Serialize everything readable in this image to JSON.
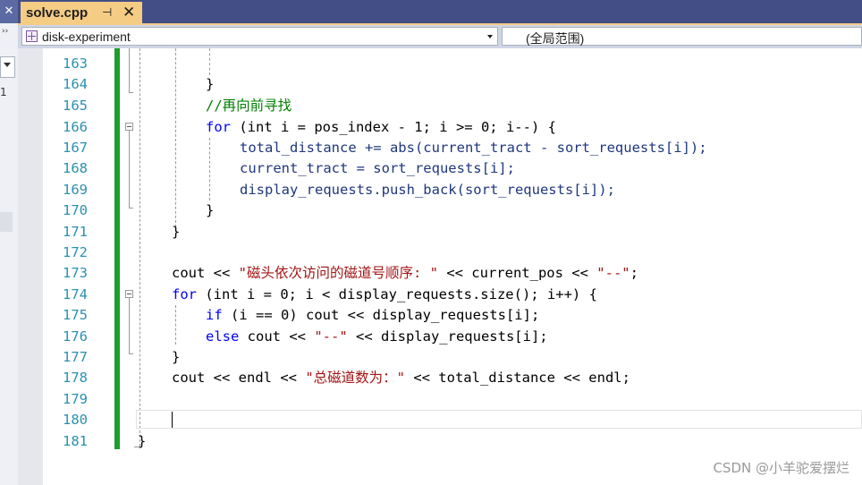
{
  "left_panel": {
    "close_glyph": "✕",
    "arrows_glyph": "››",
    "number_fragment": "1"
  },
  "tab": {
    "title": "solve.cpp",
    "pin_glyph": "⊣",
    "close_glyph": "✕"
  },
  "nav": {
    "project": "disk-experiment",
    "scope": "(全局范围)"
  },
  "editor": {
    "line_numbers": [
      "163",
      "164",
      "165",
      "166",
      "167",
      "168",
      "169",
      "170",
      "171",
      "172",
      "173",
      "174",
      "175",
      "176",
      "177",
      "178",
      "179",
      "180",
      "181"
    ],
    "lines": {
      "l164": "}",
      "l165": "//再向前寻找",
      "l166_kw": "for",
      "l166_rest": " (int i = pos_index - 1; i >= 0; i--) {",
      "l167": "total_distance += abs(current_tract - sort_requests[i]);",
      "l168": "current_tract = sort_requests[i];",
      "l169": "display_requests.push_back(sort_requests[i]);",
      "l170": "}",
      "l171": "}",
      "l173_a": "cout << ",
      "l173_str": "\"磁头依次访问的磁道号顺序: \"",
      "l173_b": " << current_pos << ",
      "l173_str2": "\"--\"",
      "l173_c": ";",
      "l174_kw": "for",
      "l174_rest": " (int i = 0; i < display_requests.size(); i++) {",
      "l175_kw": "if",
      "l175_rest": " (i == 0) cout << display_requests[i];",
      "l176_kw": "else",
      "l176_a": " cout << ",
      "l176_str": "\"--\"",
      "l176_b": " << display_requests[i];",
      "l177": "}",
      "l178_a": "cout << endl << ",
      "l178_str": "\"总磁道数为：\"",
      "l178_b": " << total_distance << endl;",
      "l181": "}"
    }
  },
  "watermark": "CSDN @小羊驼爱摆烂",
  "colors": {
    "keyword": "#0000ff",
    "comment": "#008000",
    "string": "#a31515",
    "line_number": "#2b91af",
    "change_bar": "#1f9d2c",
    "tab_active": "#f5cc84",
    "tabbar_bg": "#424e85"
  }
}
